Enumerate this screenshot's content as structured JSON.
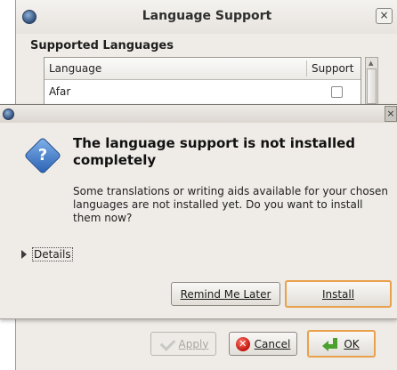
{
  "language_support": {
    "title": "Language Support",
    "close": "×",
    "section_title": "Supported Languages",
    "table": {
      "columns": [
        "Language",
        "Support"
      ],
      "rows": [
        {
          "language": "Afar",
          "supported": false
        }
      ]
    },
    "buttons": {
      "apply": "Apply",
      "cancel": "Cancel",
      "ok": "OK"
    }
  },
  "dialog": {
    "close": "×",
    "heading": "The language support is not installed completely",
    "message": "Some translations or writing aids available for your chosen languages are not installed yet. Do you want to install them now?",
    "details_label": "Details",
    "buttons": {
      "remind_later": "Remind Me Later",
      "install": "Install"
    }
  },
  "icons": {
    "window": "globe-icon",
    "question": "question-icon",
    "apply": "check-icon",
    "cancel": "cancel-icon",
    "ok": "ok-arrow-icon"
  },
  "colors": {
    "accent": "#e9a14b",
    "question": "#2a62b4"
  }
}
